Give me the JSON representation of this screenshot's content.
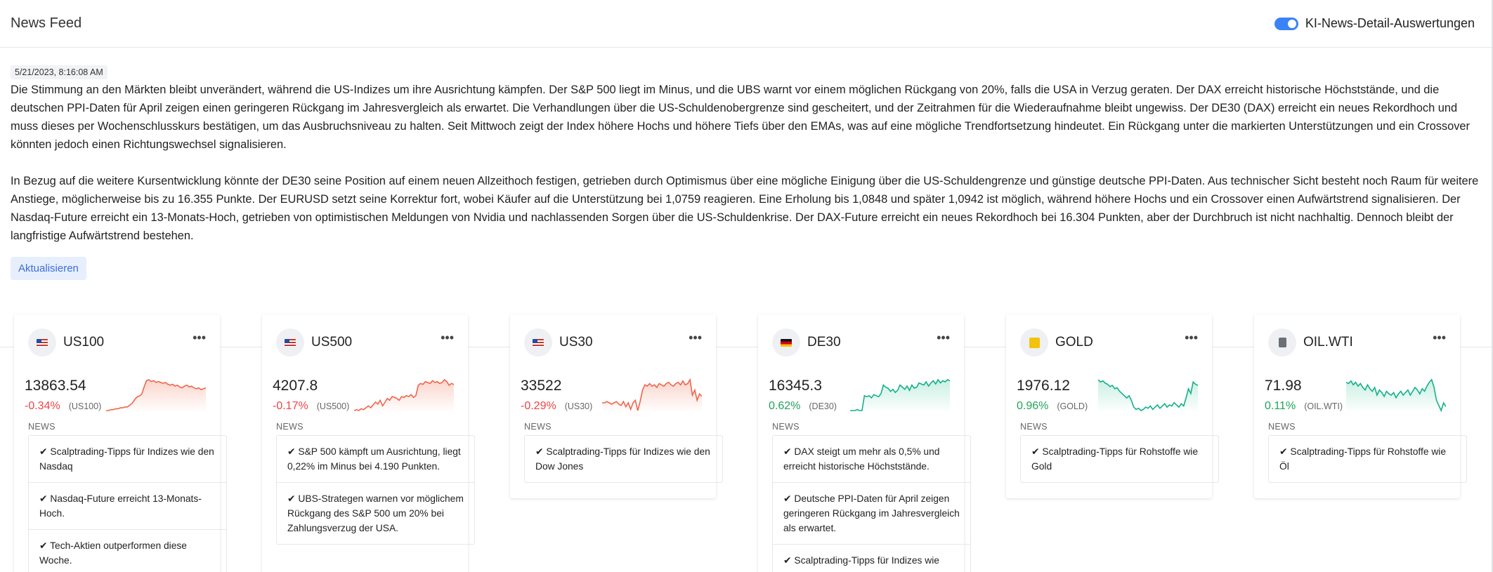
{
  "header": {
    "title": "News Feed",
    "toggle_label": "KI-News-Detail-Auswertungen",
    "toggle_on": true
  },
  "summary": {
    "timestamp": "5/21/2023, 8:16:08 AM",
    "paragraphs": [
      "Die Stimmung an den Märkten bleibt unverändert, während die US-Indizes um ihre Ausrichtung kämpfen. Der S&P 500 liegt im Minus, und die UBS warnt vor einem möglichen Rückgang von 20%, falls die USA in Verzug geraten. Der DAX erreicht historische Höchststände, und die deutschen PPI-Daten für April zeigen einen geringeren Rückgang im Jahresvergleich als erwartet. Die Verhandlungen über die US-Schuldenobergrenze sind gescheitert, und der Zeitrahmen für die Wiederaufnahme bleibt ungewiss. Der DE30 (DAX) erreicht ein neues Rekordhoch und muss dieses per Wochenschlusskurs bestätigen, um das Ausbruchsniveau zu halten. Seit Mittwoch zeigt der Index höhere Hochs und höhere Tiefs über den EMAs, was auf eine mögliche Trendfortsetzung hindeutet. Ein Rückgang unter die markierten Unterstützungen und ein Crossover könnten jedoch einen Richtungswechsel signalisieren.",
      "In Bezug auf die weitere Kursentwicklung könnte der DE30 seine Position auf einem neuen Allzeithoch festigen, getrieben durch Optimismus über eine mögliche Einigung über die US-Schuldengrenze und günstige deutsche PPI-Daten. Aus technischer Sicht besteht noch Raum für weitere Anstiege, möglicherweise bis zu 16.355 Punkte. Der EURUSD setzt seine Korrektur fort, wobei Käufer auf die Unterstützung bei 1,0759 reagieren. Eine Erholung bis 1,0848 und später 1,0942 ist möglich, während höhere Hochs und ein Crossover einen Aufwärtstrend signalisieren. Der Nasdaq-Future erreicht ein 13-Monats-Hoch, getrieben von optimistischen Meldungen von Nvidia und nachlassenden Sorgen über die US-Schuldenkrise. Der DAX-Future erreicht ein neues Rekordhoch bei 16.304 Punkten, aber der Durchbruch ist nicht nachhaltig. Dennoch bleibt der langfristige Aufwärtstrend bestehen."
    ],
    "refresh_label": "Aktualisieren"
  },
  "news_label": "NEWS",
  "colors": {
    "negative": "#ef4444",
    "positive": "#22a35a",
    "negative_fill": "#fbd5cc",
    "positive_fill": "#c9efe3",
    "teal_line": "#14b08a",
    "red_line": "#f0654b"
  },
  "cards": [
    {
      "symbol": "US100",
      "icon": "us-flag",
      "price": "13863.54",
      "change": "-0.34%",
      "ticker": "(US100)",
      "direction": "down",
      "sparkline": [
        2,
        2,
        3,
        3,
        4,
        4,
        5,
        5,
        6,
        6,
        8,
        10,
        14,
        17,
        18,
        20,
        28,
        35,
        36,
        34,
        35,
        33,
        34,
        33,
        32,
        33,
        31,
        30,
        31,
        29,
        30,
        28,
        27,
        29,
        30,
        28,
        29,
        27,
        26,
        27,
        25,
        26,
        27
      ],
      "news": [
        "Scalptrading-Tipps für Indizes wie den Nasdaq",
        "Nasdaq-Future erreicht 13-Monats-Hoch.",
        "Tech-Aktien outperformen diese Woche."
      ]
    },
    {
      "symbol": "US500",
      "icon": "us-flag",
      "price": "4207.8",
      "change": "-0.17%",
      "ticker": "(US500)",
      "direction": "down",
      "sparkline": [
        3,
        4,
        3,
        5,
        4,
        6,
        8,
        6,
        9,
        12,
        10,
        14,
        8,
        12,
        16,
        14,
        18,
        17,
        16,
        14,
        18,
        17,
        19,
        18,
        20,
        17,
        19,
        30,
        32,
        31,
        34,
        33,
        32,
        35,
        33,
        34,
        32,
        33,
        36,
        34,
        30,
        32,
        31
      ],
      "news": [
        "S&P 500 kämpft um Ausrichtung, liegt 0,22% im Minus bei 4.190 Punkten.",
        "UBS-Strategen warnen vor möglichem Rückgang des S&P 500 um 20% bei Zahlungsverzug der USA."
      ]
    },
    {
      "symbol": "US30",
      "icon": "us-flag",
      "price": "33522",
      "change": "-0.29%",
      "ticker": "(US30)",
      "direction": "down",
      "sparkline": [
        20,
        20,
        21,
        20,
        19,
        20,
        21,
        19,
        18,
        21,
        17,
        20,
        15,
        20,
        22,
        14,
        21,
        30,
        34,
        33,
        35,
        33,
        34,
        32,
        35,
        34,
        33,
        35,
        36,
        34,
        33,
        35,
        36,
        34,
        37,
        34,
        35,
        38,
        26,
        30,
        22,
        27,
        25
      ],
      "news": [
        "Scalptrading-Tipps für Indizes wie den Dow Jones"
      ]
    },
    {
      "symbol": "DE30",
      "icon": "de-flag",
      "price": "16345.3",
      "change": "0.62%",
      "ticker": "(DE30)",
      "direction": "up",
      "sparkline": [
        4,
        4,
        4,
        5,
        4,
        4,
        18,
        17,
        18,
        16,
        19,
        18,
        17,
        20,
        28,
        26,
        25,
        22,
        24,
        21,
        23,
        28,
        26,
        24,
        27,
        23,
        28,
        25,
        26,
        30,
        29,
        28,
        31,
        27,
        30,
        32,
        29,
        33,
        30,
        32,
        31,
        33,
        32
      ],
      "news": [
        "DAX steigt um mehr als 0,5% und erreicht historische Höchststände.",
        "Deutsche PPI-Daten für April zeigen geringeren Rückgang im Jahresvergleich als erwartet.",
        "Scalptrading-Tipps für Indizes wie"
      ]
    },
    {
      "symbol": "GOLD",
      "icon": "gold-icon",
      "price": "1976.12",
      "change": "0.96%",
      "ticker": "(GOLD)",
      "direction": "up",
      "sparkline": [
        38,
        36,
        37,
        35,
        34,
        32,
        33,
        30,
        31,
        28,
        26,
        24,
        22,
        24,
        20,
        14,
        12,
        13,
        11,
        12,
        14,
        13,
        15,
        12,
        14,
        16,
        13,
        15,
        17,
        14,
        16,
        15,
        18,
        16,
        14,
        17,
        15,
        22,
        30,
        26,
        36,
        34,
        33
      ],
      "news": [
        "Scalptrading-Tipps für Rohstoffe wie Gold"
      ]
    },
    {
      "symbol": "OIL.WTI",
      "icon": "oil-icon",
      "price": "71.98",
      "change": "0.11%",
      "ticker": "(OIL.WTI)",
      "direction": "up",
      "sparkline": [
        28,
        27,
        29,
        26,
        28,
        25,
        27,
        24,
        22,
        26,
        23,
        21,
        24,
        18,
        22,
        20,
        17,
        21,
        19,
        18,
        20,
        16,
        19,
        21,
        18,
        20,
        22,
        18,
        21,
        24,
        22,
        19,
        23,
        21,
        25,
        28,
        30,
        24,
        14,
        10,
        6,
        12,
        9
      ],
      "news": [
        "Scalptrading-Tipps für Rohstoffe wie Öl"
      ]
    }
  ]
}
